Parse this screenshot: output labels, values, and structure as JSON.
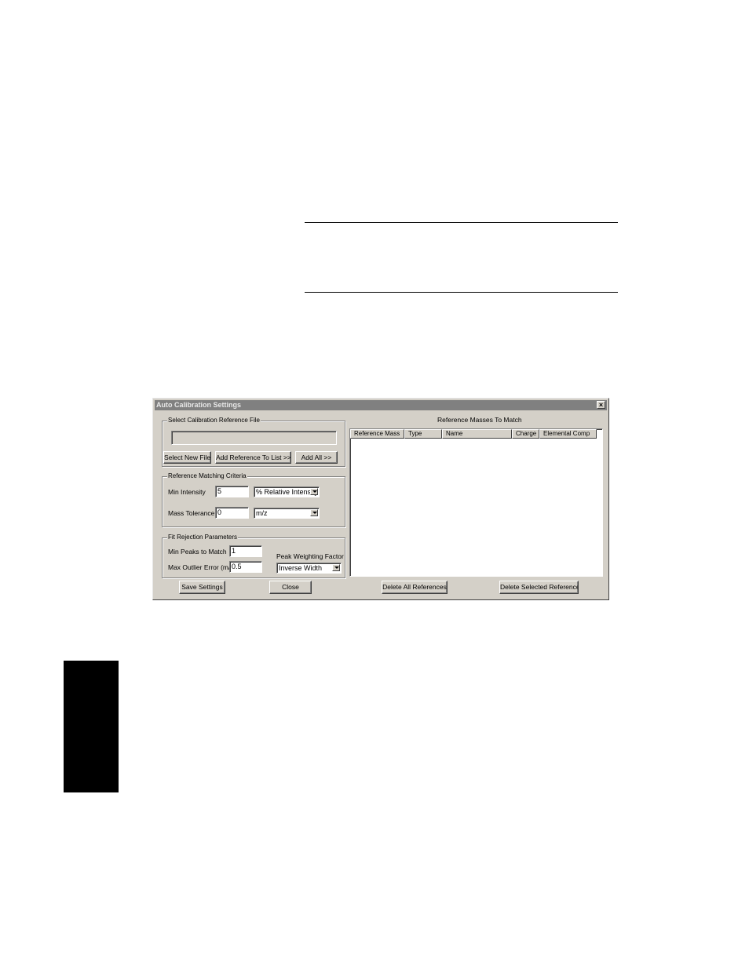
{
  "window": {
    "title": "Auto Calibration Settings",
    "close_glyph": "×"
  },
  "reference_file_group": {
    "legend": "Select Calibration Reference File",
    "file_path": "",
    "select_new_file_label": "Select New File",
    "add_reference_label": "Add Reference To List >>",
    "add_all_label": "Add All >>"
  },
  "matching_criteria_group": {
    "legend": "Reference Matching Criteria",
    "min_intensity_label": "Min Intensity",
    "min_intensity_value": "5",
    "intensity_unit_selected": "% Relative Intensity",
    "mass_tolerance_label": "Mass Tolerance",
    "mass_tolerance_value": "0",
    "tolerance_unit_selected": "m/z"
  },
  "fit_rejection_group": {
    "legend": "Fit Rejection Parameters",
    "min_peaks_label": "Min Peaks to Match",
    "min_peaks_value": "1",
    "max_outlier_label": "Max Outlier Error (m/z)",
    "max_outlier_value": "0.5",
    "peak_weighting_label": "Peak Weighting Factor",
    "peak_weighting_selected": "Inverse Width"
  },
  "reference_list": {
    "title": "Reference Masses To Match",
    "columns": [
      "Reference Mass",
      "Type",
      "Name",
      "Charge",
      "Elemental Comp"
    ],
    "rows": []
  },
  "buttons": {
    "save_settings": "Save Settings",
    "close": "Close",
    "delete_all": "Delete All References",
    "delete_selected": "Delete Selected Reference"
  },
  "colors": {
    "dialog_face": "#d4d0c8",
    "titlebar_inactive": "#808080",
    "page_tab": "#000000"
  },
  "icons": {
    "close": "close-icon",
    "dropdown": "chevron-down-icon"
  }
}
